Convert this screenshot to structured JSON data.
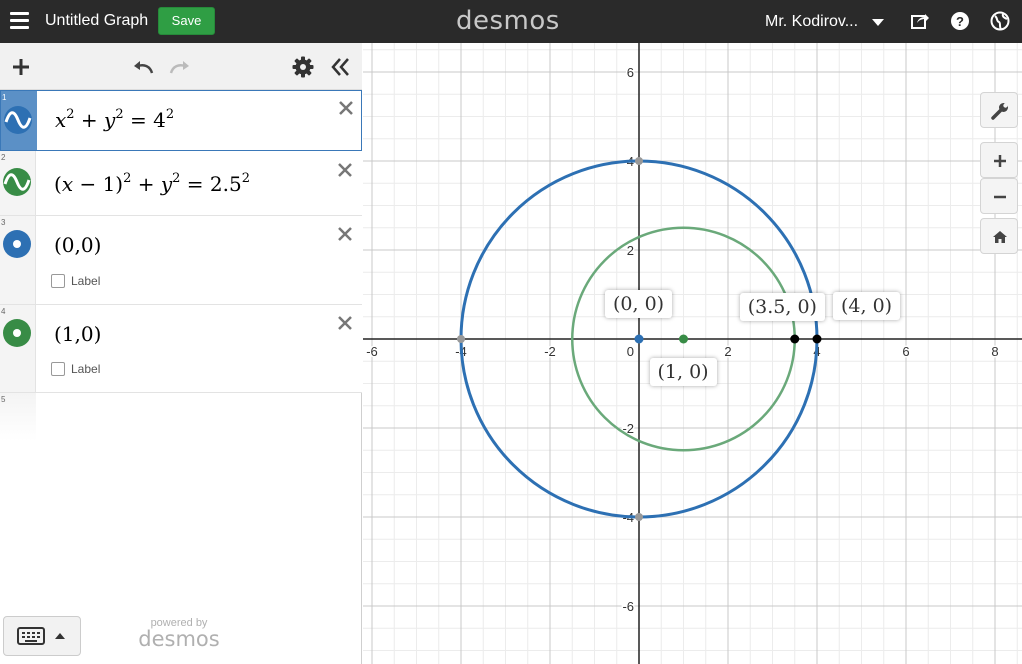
{
  "topbar": {
    "graph_title": "Untitled Graph",
    "save_label": "Save",
    "logo": "desmos",
    "user_name": "Mr. Kodirov...",
    "icons": [
      "menu-icon",
      "share-icon",
      "help-icon",
      "language-icon"
    ]
  },
  "expressions": [
    {
      "num": "1",
      "latex": "x^2+y^2=4^2",
      "color": "#2d70b3",
      "type": "curve"
    },
    {
      "num": "2",
      "latex": "(x-1)^2+y^2=2.5^2",
      "color": "#388c46",
      "type": "curve"
    },
    {
      "num": "3",
      "text": "(0,0)",
      "color": "#2d70b3",
      "type": "point",
      "label_text": "Label"
    },
    {
      "num": "4",
      "text": "(1,0)",
      "color": "#388c46",
      "type": "point",
      "label_text": "Label"
    },
    {
      "num": "5"
    }
  ],
  "footer": {
    "powered_by": "powered by",
    "logo": "desmos"
  },
  "chart_data": {
    "type": "scatter",
    "x_ticks": [
      "-6",
      "-4",
      "-2",
      "0",
      "2",
      "4",
      "6",
      "8"
    ],
    "y_ticks": [
      "6",
      "4",
      "2",
      "-2",
      "-4",
      "-6"
    ],
    "xlim": [
      -6.1,
      8.6
    ],
    "ylim": [
      -7.2,
      6.8
    ],
    "grid": true,
    "curves": [
      {
        "shape": "circle",
        "center": [
          0,
          0
        ],
        "r": 4,
        "color": "#2d70b3"
      },
      {
        "shape": "circle",
        "center": [
          1,
          0
        ],
        "r": 2.5,
        "color": "#6aa97a"
      }
    ],
    "points": [
      {
        "x": 0,
        "y": 0,
        "color": "#2d70b3",
        "label": "(0, 0)"
      },
      {
        "x": 1,
        "y": 0,
        "color": "#388c46",
        "label": "(1, 0)"
      },
      {
        "x": 3.5,
        "y": 0,
        "color": "#000000",
        "label": "(3.5, 0)"
      },
      {
        "x": 4,
        "y": 0,
        "color": "#000000",
        "label": "(4, 0)"
      },
      {
        "x": -4,
        "y": 0,
        "color": "#999999"
      },
      {
        "x": 0,
        "y": 4,
        "color": "#999999"
      },
      {
        "x": 0,
        "y": -4,
        "color": "#999999"
      }
    ]
  }
}
